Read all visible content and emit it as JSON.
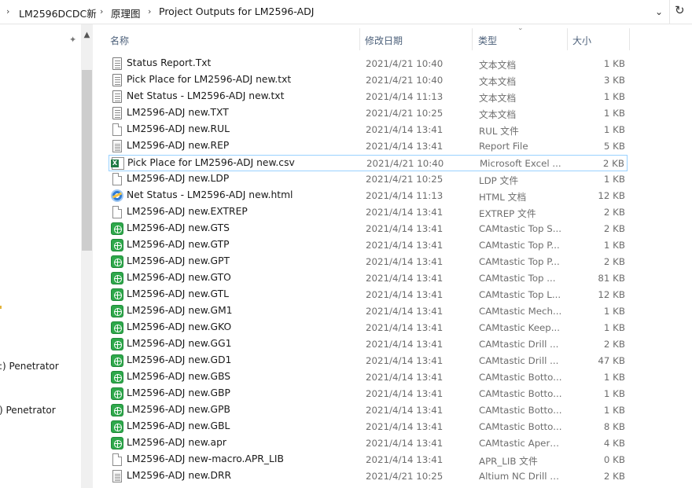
{
  "address": {
    "crumbs": [
      "LM2596DCDC新",
      "原理图",
      "Project Outputs for LM2596-ADJ"
    ]
  },
  "nav": {
    "items": [
      ":) Penetrator",
      ") Penetrator"
    ]
  },
  "columns": {
    "name": "名称",
    "date": "修改日期",
    "type": "类型",
    "size": "大小"
  },
  "files": [
    {
      "name": "Status Report.Txt",
      "date": "2021/4/21 10:40",
      "type": "文本文档",
      "size": "1 KB",
      "icon": "text-doc-icon"
    },
    {
      "name": "Pick Place for LM2596-ADJ new.txt",
      "date": "2021/4/21 10:40",
      "type": "文本文档",
      "size": "3 KB",
      "icon": "text-doc-icon"
    },
    {
      "name": "Net Status - LM2596-ADJ new.txt",
      "date": "2021/4/14 11:13",
      "type": "文本文档",
      "size": "1 KB",
      "icon": "text-doc-icon"
    },
    {
      "name": "LM2596-ADJ new.TXT",
      "date": "2021/4/21 10:25",
      "type": "文本文档",
      "size": "1 KB",
      "icon": "text-doc-icon"
    },
    {
      "name": "LM2596-ADJ new.RUL",
      "date": "2021/4/14 13:41",
      "type": "RUL 文件",
      "size": "1 KB",
      "icon": "blank-file-icon"
    },
    {
      "name": "LM2596-ADJ new.REP",
      "date": "2021/4/14 13:41",
      "type": "Report File",
      "size": "5 KB",
      "icon": "report-file-icon"
    },
    {
      "name": "Pick Place for LM2596-ADJ new.csv",
      "date": "2021/4/21 10:40",
      "type": "Microsoft Excel ...",
      "size": "2 KB",
      "icon": "excel-file-icon",
      "selected": true
    },
    {
      "name": "LM2596-ADJ new.LDP",
      "date": "2021/4/21 10:25",
      "type": "LDP 文件",
      "size": "1 KB",
      "icon": "blank-file-icon"
    },
    {
      "name": "Net Status - LM2596-ADJ new.html",
      "date": "2021/4/14 11:13",
      "type": "HTML 文档",
      "size": "12 KB",
      "icon": "html-file-icon"
    },
    {
      "name": "LM2596-ADJ new.EXTREP",
      "date": "2021/4/14 13:41",
      "type": "EXTREP 文件",
      "size": "2 KB",
      "icon": "blank-file-icon"
    },
    {
      "name": "LM2596-ADJ new.GTS",
      "date": "2021/4/14 13:41",
      "type": "CAMtastic Top S...",
      "size": "2 KB",
      "icon": "camtastic-file-icon"
    },
    {
      "name": "LM2596-ADJ new.GTP",
      "date": "2021/4/14 13:41",
      "type": "CAMtastic Top P...",
      "size": "1 KB",
      "icon": "camtastic-file-icon"
    },
    {
      "name": "LM2596-ADJ new.GPT",
      "date": "2021/4/14 13:41",
      "type": "CAMtastic Top P...",
      "size": "2 KB",
      "icon": "camtastic-file-icon"
    },
    {
      "name": "LM2596-ADJ new.GTO",
      "date": "2021/4/14 13:41",
      "type": "CAMtastic Top ...",
      "size": "81 KB",
      "icon": "camtastic-file-icon"
    },
    {
      "name": "LM2596-ADJ new.GTL",
      "date": "2021/4/14 13:41",
      "type": "CAMtastic Top L...",
      "size": "12 KB",
      "icon": "camtastic-file-icon"
    },
    {
      "name": "LM2596-ADJ new.GM1",
      "date": "2021/4/14 13:41",
      "type": "CAMtastic Mech...",
      "size": "1 KB",
      "icon": "camtastic-file-icon"
    },
    {
      "name": "LM2596-ADJ new.GKO",
      "date": "2021/4/14 13:41",
      "type": "CAMtastic Keep...",
      "size": "1 KB",
      "icon": "camtastic-file-icon"
    },
    {
      "name": "LM2596-ADJ new.GG1",
      "date": "2021/4/14 13:41",
      "type": "CAMtastic Drill ...",
      "size": "2 KB",
      "icon": "camtastic-file-icon"
    },
    {
      "name": "LM2596-ADJ new.GD1",
      "date": "2021/4/14 13:41",
      "type": "CAMtastic Drill ...",
      "size": "47 KB",
      "icon": "camtastic-file-icon"
    },
    {
      "name": "LM2596-ADJ new.GBS",
      "date": "2021/4/14 13:41",
      "type": "CAMtastic Botto...",
      "size": "1 KB",
      "icon": "camtastic-file-icon"
    },
    {
      "name": "LM2596-ADJ new.GBP",
      "date": "2021/4/14 13:41",
      "type": "CAMtastic Botto...",
      "size": "1 KB",
      "icon": "camtastic-file-icon"
    },
    {
      "name": "LM2596-ADJ new.GPB",
      "date": "2021/4/14 13:41",
      "type": "CAMtastic Botto...",
      "size": "1 KB",
      "icon": "camtastic-file-icon"
    },
    {
      "name": "LM2596-ADJ new.GBL",
      "date": "2021/4/14 13:41",
      "type": "CAMtastic Botto...",
      "size": "8 KB",
      "icon": "camtastic-file-icon"
    },
    {
      "name": "LM2596-ADJ new.apr",
      "date": "2021/4/14 13:41",
      "type": "CAMtastic Apert...",
      "size": "4 KB",
      "icon": "camtastic-file-icon"
    },
    {
      "name": "LM2596-ADJ new-macro.APR_LIB",
      "date": "2021/4/14 13:41",
      "type": "APR_LIB 文件",
      "size": "0 KB",
      "icon": "blank-file-icon"
    },
    {
      "name": "LM2596-ADJ new.DRR",
      "date": "2021/4/21 10:25",
      "type": "Altium NC Drill R...",
      "size": "2 KB",
      "icon": "report-file-icon"
    }
  ]
}
